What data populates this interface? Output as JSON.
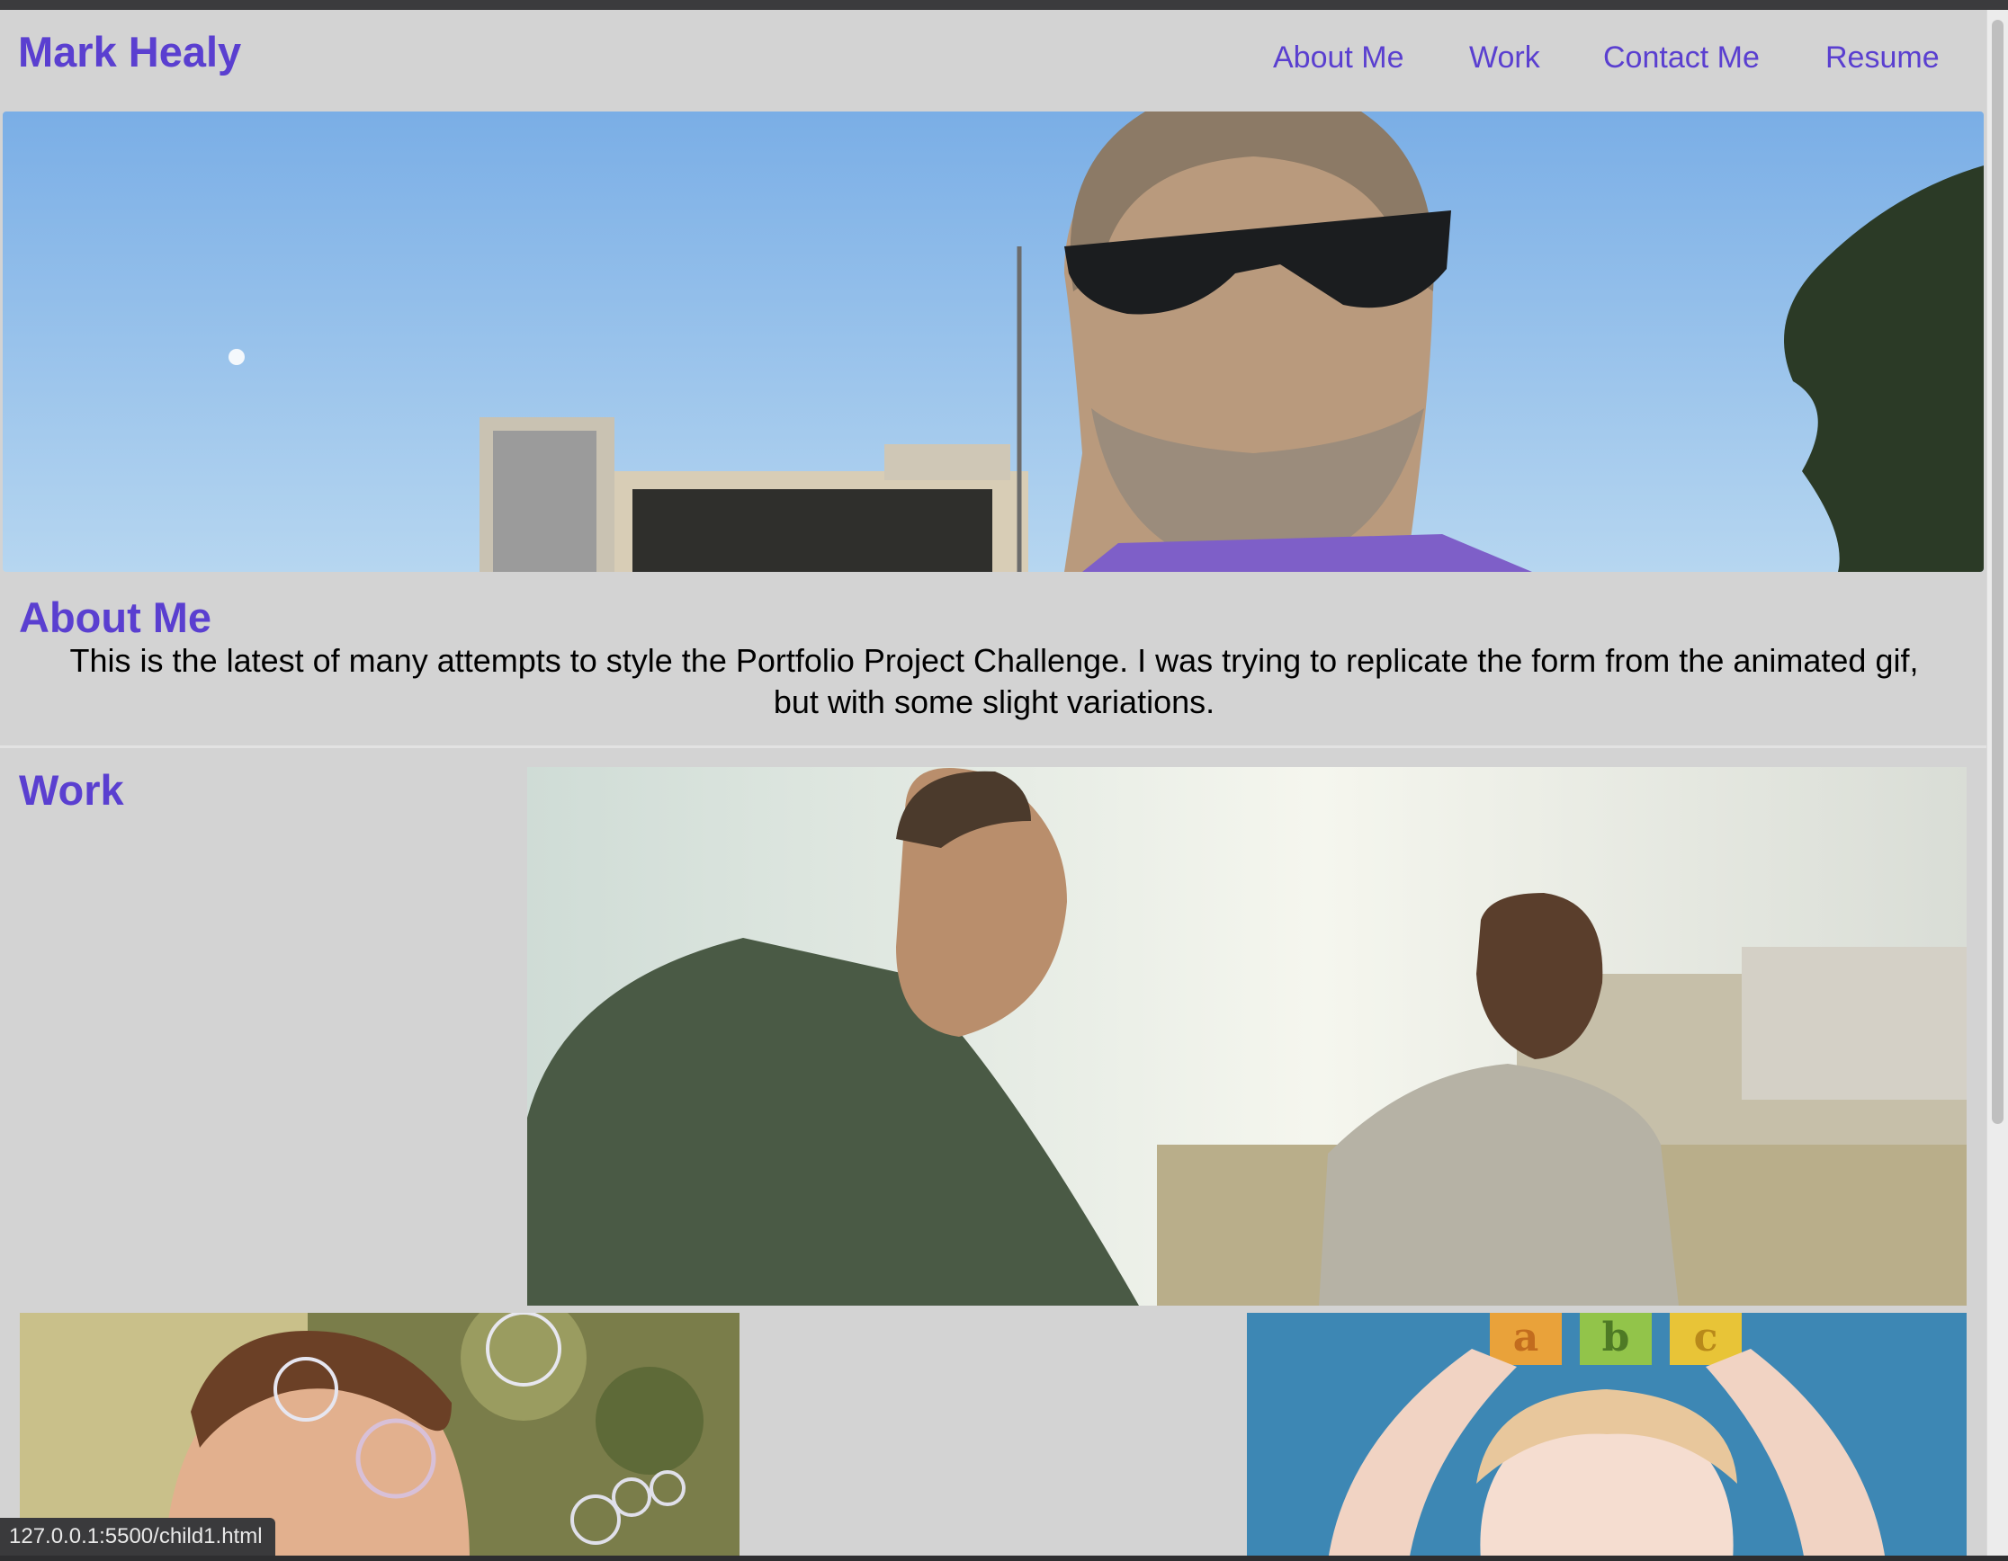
{
  "header": {
    "brand": "Mark Healy",
    "nav": [
      {
        "label": "About Me"
      },
      {
        "label": "Work"
      },
      {
        "label": "Contact Me"
      },
      {
        "label": "Resume"
      }
    ]
  },
  "about": {
    "heading": "About Me",
    "text": "This is the latest of many attempts to style the Portfolio Project Challenge. I was trying to replicate the form from the animated gif, but with some slight variations."
  },
  "work": {
    "heading": "Work"
  },
  "status_bar": {
    "url": "127.0.0.1:5500/child1.html"
  },
  "colors": {
    "accent": "#5a3fd0",
    "page_background": "#d3d3d3"
  }
}
